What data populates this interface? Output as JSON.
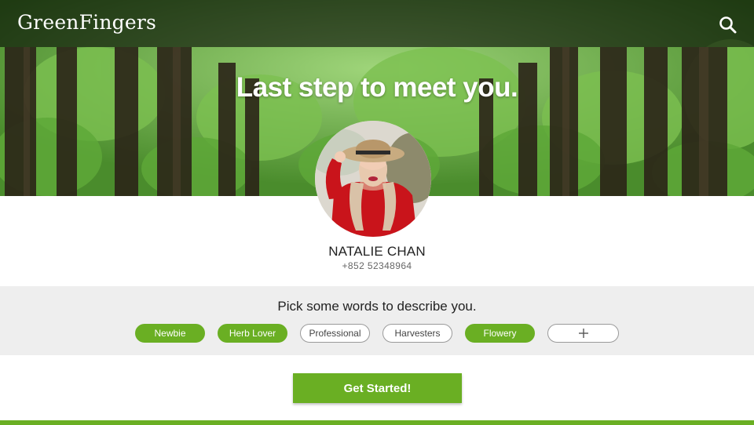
{
  "header": {
    "logo_text": "GreenFingers",
    "search_icon": "search-icon"
  },
  "hero": {
    "title": "Last step to meet you."
  },
  "profile": {
    "name": "NATALIE CHAN",
    "phone": "+852 52348964"
  },
  "tags": {
    "prompt": "Pick some words to describe you.",
    "items": [
      {
        "label": "Newbie",
        "selected": true
      },
      {
        "label": "Herb Lover",
        "selected": true
      },
      {
        "label": "Professional",
        "selected": false
      },
      {
        "label": "Harvesters",
        "selected": false
      },
      {
        "label": "Flowery",
        "selected": true
      }
    ],
    "add_icon": "plus-icon"
  },
  "cta": {
    "label": "Get Started!"
  },
  "colors": {
    "accent": "#6aaf23",
    "panel": "#eeeeee",
    "topbar": "#000000"
  }
}
